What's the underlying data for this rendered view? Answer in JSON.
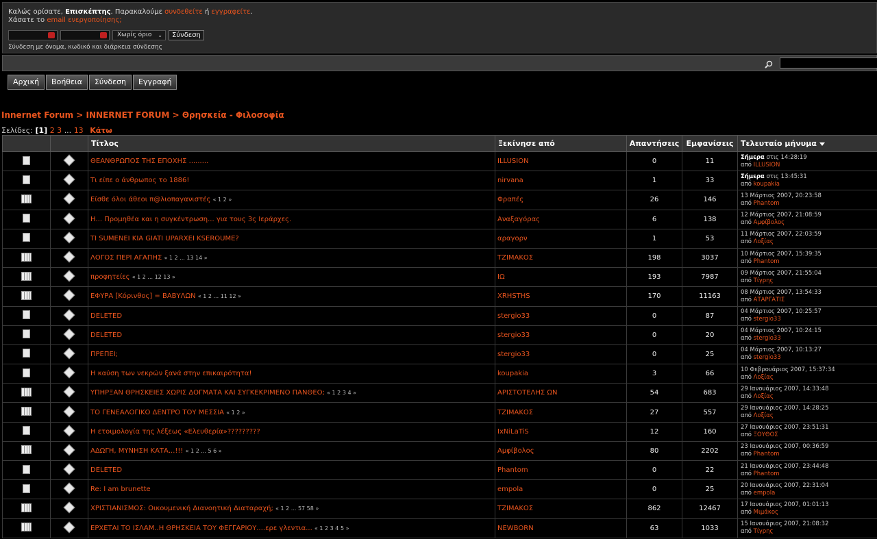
{
  "userbox": {
    "welcome": "Καλώς ορίσατε,",
    "guest": "Επισκέπτης",
    "please": ". Παρακαλούμε",
    "login_link": "συνδεθείτε",
    "or": "ή",
    "register_link": "εγγραφείτε",
    "lost": "Χάσατε το",
    "activation_link": "email ενεργοποίησης;",
    "duration_value": "Χωρίς όριο",
    "login_button": "Σύνδεση",
    "hint": "Σύνδεση με όνομα, κωδικό και διάρκεια σύνδεσης"
  },
  "nav": [
    "Αρχική",
    "Βοήθεια",
    "Σύνδεση",
    "Εγγραφή"
  ],
  "breadcrumb": "Innernet Forum > INNERNET FORUM > Θρησκεία - Φιλοσοφία",
  "pages": {
    "label": "Σελίδες:",
    "current": "[1]",
    "links": "2 3",
    "ellipsis": "...",
    "last": "13",
    "down": "Κάτω"
  },
  "columns": {
    "title": "Τίτλος",
    "author": "Ξεκίνησε από",
    "replies": "Απαντήσεις",
    "views": "Εμφανίσεις",
    "last": "Τελευταίο μήνυμα"
  },
  "topics": [
    {
      "title": "ΘΕΑΝΘΡΩΠΟΣ ΤΗΣ ΕΠΟΧΗΣ .........",
      "pages": "",
      "author": "ILLUSION",
      "replies": "0",
      "views": "11",
      "date_bold": "Σήμερα",
      "date": "στις 14:28:19",
      "by": "από",
      "last_user": "ILLUSION",
      "multi": false
    },
    {
      "title": "Τι είπε ο άνθρωπος το 1886!",
      "pages": "",
      "author": "nirvana",
      "replies": "1",
      "views": "33",
      "date_bold": "Σήμερα",
      "date": "στις 13:45:31",
      "by": "από",
      "last_user": "koupakia",
      "multi": false
    },
    {
      "title": "Είσθε όλοι άθεοι π@λιοπαγανιστές",
      "pages": "« 1 2 »",
      "author": "Φραπές",
      "replies": "26",
      "views": "146",
      "date_bold": "",
      "date": "13 Μάρτιος 2007, 20:23:58",
      "by": "από",
      "last_user": "Phantom",
      "multi": true
    },
    {
      "title": "Η... Προμηθέα και η συγκέντρωση... για τους 3ς Ιεράρχες.",
      "pages": "",
      "author": "Αναξαγόρας",
      "replies": "6",
      "views": "138",
      "date_bold": "",
      "date": "12 Μάρτιος 2007, 21:08:59",
      "by": "από",
      "last_user": "Αμφίβολος",
      "multi": false
    },
    {
      "title": "TI SUMENEI KIA GIATI UPARXEI KSEROUME?",
      "pages": "",
      "author": "αραγορν",
      "replies": "1",
      "views": "53",
      "date_bold": "",
      "date": "11 Μάρτιος 2007, 22:03:59",
      "by": "από",
      "last_user": "Λοξίας",
      "multi": false
    },
    {
      "title": "ΛΟΓΟΣ ΠΕΡΙ ΑΓΑΠΗΣ",
      "pages": "« 1 2 ... 13 14 »",
      "author": "ΤΖΙΜΑΚΟΣ",
      "replies": "198",
      "views": "3037",
      "date_bold": "",
      "date": "10 Μάρτιος 2007, 15:39:35",
      "by": "από",
      "last_user": "Phantom",
      "multi": true
    },
    {
      "title": "προφητείες",
      "pages": "« 1 2 ... 12 13 »",
      "author": "ΙΩ",
      "replies": "193",
      "views": "7987",
      "date_bold": "",
      "date": "09 Μάρτιος 2007, 21:55:04",
      "by": "από",
      "last_user": "Τίγρης",
      "multi": true
    },
    {
      "title": "ΕΦΥΡΑ [Κόρινθος] = ΒΑΒΥΛΩΝ",
      "pages": "« 1 2 ... 11 12 »",
      "author": "XRHSTHS",
      "replies": "170",
      "views": "11163",
      "date_bold": "",
      "date": "08 Μάρτιος 2007, 13:54:33",
      "by": "από",
      "last_user": "ΑΤΑΡΓΑΤΙΣ",
      "multi": true
    },
    {
      "title": "DELETED",
      "pages": "",
      "author": "stergio33",
      "replies": "0",
      "views": "87",
      "date_bold": "",
      "date": "04 Μάρτιος 2007, 10:25:57",
      "by": "από",
      "last_user": "stergio33",
      "multi": false
    },
    {
      "title": "DELETED",
      "pages": "",
      "author": "stergio33",
      "replies": "0",
      "views": "20",
      "date_bold": "",
      "date": "04 Μάρτιος 2007, 10:24:15",
      "by": "από",
      "last_user": "stergio33",
      "multi": false
    },
    {
      "title": "ΠΡΕΠΕΙ;",
      "pages": "",
      "author": "stergio33",
      "replies": "0",
      "views": "25",
      "date_bold": "",
      "date": "04 Μάρτιος 2007, 10:13:27",
      "by": "από",
      "last_user": "stergio33",
      "multi": false
    },
    {
      "title": "Η καύση των νεκρών ξανά στην επικαιρότητα!",
      "pages": "",
      "author": "koupakia",
      "replies": "3",
      "views": "66",
      "date_bold": "",
      "date": "10 Φεβρουάριος 2007, 15:37:34",
      "by": "από",
      "last_user": "Λοξίας",
      "multi": false
    },
    {
      "title": "ΥΠΗΡΞΑΝ ΘΡΗΣΚΕΙΕΣ ΧΩΡΙΣ ΔΟΓΜΑΤΑ ΚΑΙ ΣΥΓΚΕΚΡΙΜΕΝΟ ΠΑΝΘΕΟ;",
      "pages": "« 1 2 3 4 »",
      "author": "ΑΡΙΣΤΟΤΕΛΗΣ ΩΝ",
      "replies": "54",
      "views": "683",
      "date_bold": "",
      "date": "29 Ιανουάριος 2007, 14:33:48",
      "by": "από",
      "last_user": "Λοξίας",
      "multi": true
    },
    {
      "title": "ΤΟ ΓΕΝΕΑΛΟΓΙΚΟ ΔΕΝΤΡΟ ΤΟΥ ΜΕΣΣΙΑ",
      "pages": "« 1 2 »",
      "author": "ΤΖΙΜΑΚΟΣ",
      "replies": "27",
      "views": "557",
      "date_bold": "",
      "date": "29 Ιανουάριος 2007, 14:28:25",
      "by": "από",
      "last_user": "Λοξίας",
      "multi": true
    },
    {
      "title": "Η ετοιμολογία της λέξεως «Ελευθερία»?????????",
      "pages": "",
      "author": "IxNiLaTiS",
      "replies": "12",
      "views": "160",
      "date_bold": "",
      "date": "27 Ιανουάριος 2007, 23:51:31",
      "by": "από",
      "last_user": "ΞΟΥΘΟΣ",
      "multi": false
    },
    {
      "title": "ΑΔΩΓΗ, ΜΥΝΗΣΗ ΚΑΤΑ...!!!",
      "pages": "« 1 2 ... 5 6 »",
      "author": "Αμφίβολος",
      "replies": "80",
      "views": "2202",
      "date_bold": "",
      "date": "23 Ιανουάριος 2007, 00:36:59",
      "by": "από",
      "last_user": "Phantom",
      "multi": true
    },
    {
      "title": "DELETED",
      "pages": "",
      "author": "Phantom",
      "replies": "0",
      "views": "22",
      "date_bold": "",
      "date": "21 Ιανουάριος 2007, 23:44:48",
      "by": "από",
      "last_user": "Phantom",
      "multi": false
    },
    {
      "title": "Re: I am brunette",
      "pages": "",
      "author": "empola",
      "replies": "0",
      "views": "25",
      "date_bold": "",
      "date": "20 Ιανουάριος 2007, 22:31:04",
      "by": "από",
      "last_user": "empola",
      "multi": false
    },
    {
      "title": "ΧΡΙΣΤΙΑΝΙΣΜΟΣ: Οικουμενική Διανοητική Διαταραχή;",
      "pages": "« 1 2 ... 57 58 »",
      "author": "ΤΖΙΜΑΚΟΣ",
      "replies": "862",
      "views": "12467",
      "date_bold": "",
      "date": "17 Ιανουάριος 2007, 01:01:13",
      "by": "από",
      "last_user": "Μιμάκος",
      "multi": true
    },
    {
      "title": "ΕΡΧΕΤΑΙ ΤΟ ΙΣΛΑΜ..Η ΘΡΗΣΚΕΙΑ ΤΟΥ ΦΕΓΓΑΡΙΟΥ....ερε γλεντια...",
      "pages": "« 1 2 3 4 5 »",
      "author": "NEWBORN",
      "replies": "63",
      "views": "1033",
      "date_bold": "",
      "date": "15 Ιανουάριος 2007, 21:08:32",
      "by": "από",
      "last_user": "Τίγρης",
      "multi": true
    }
  ]
}
